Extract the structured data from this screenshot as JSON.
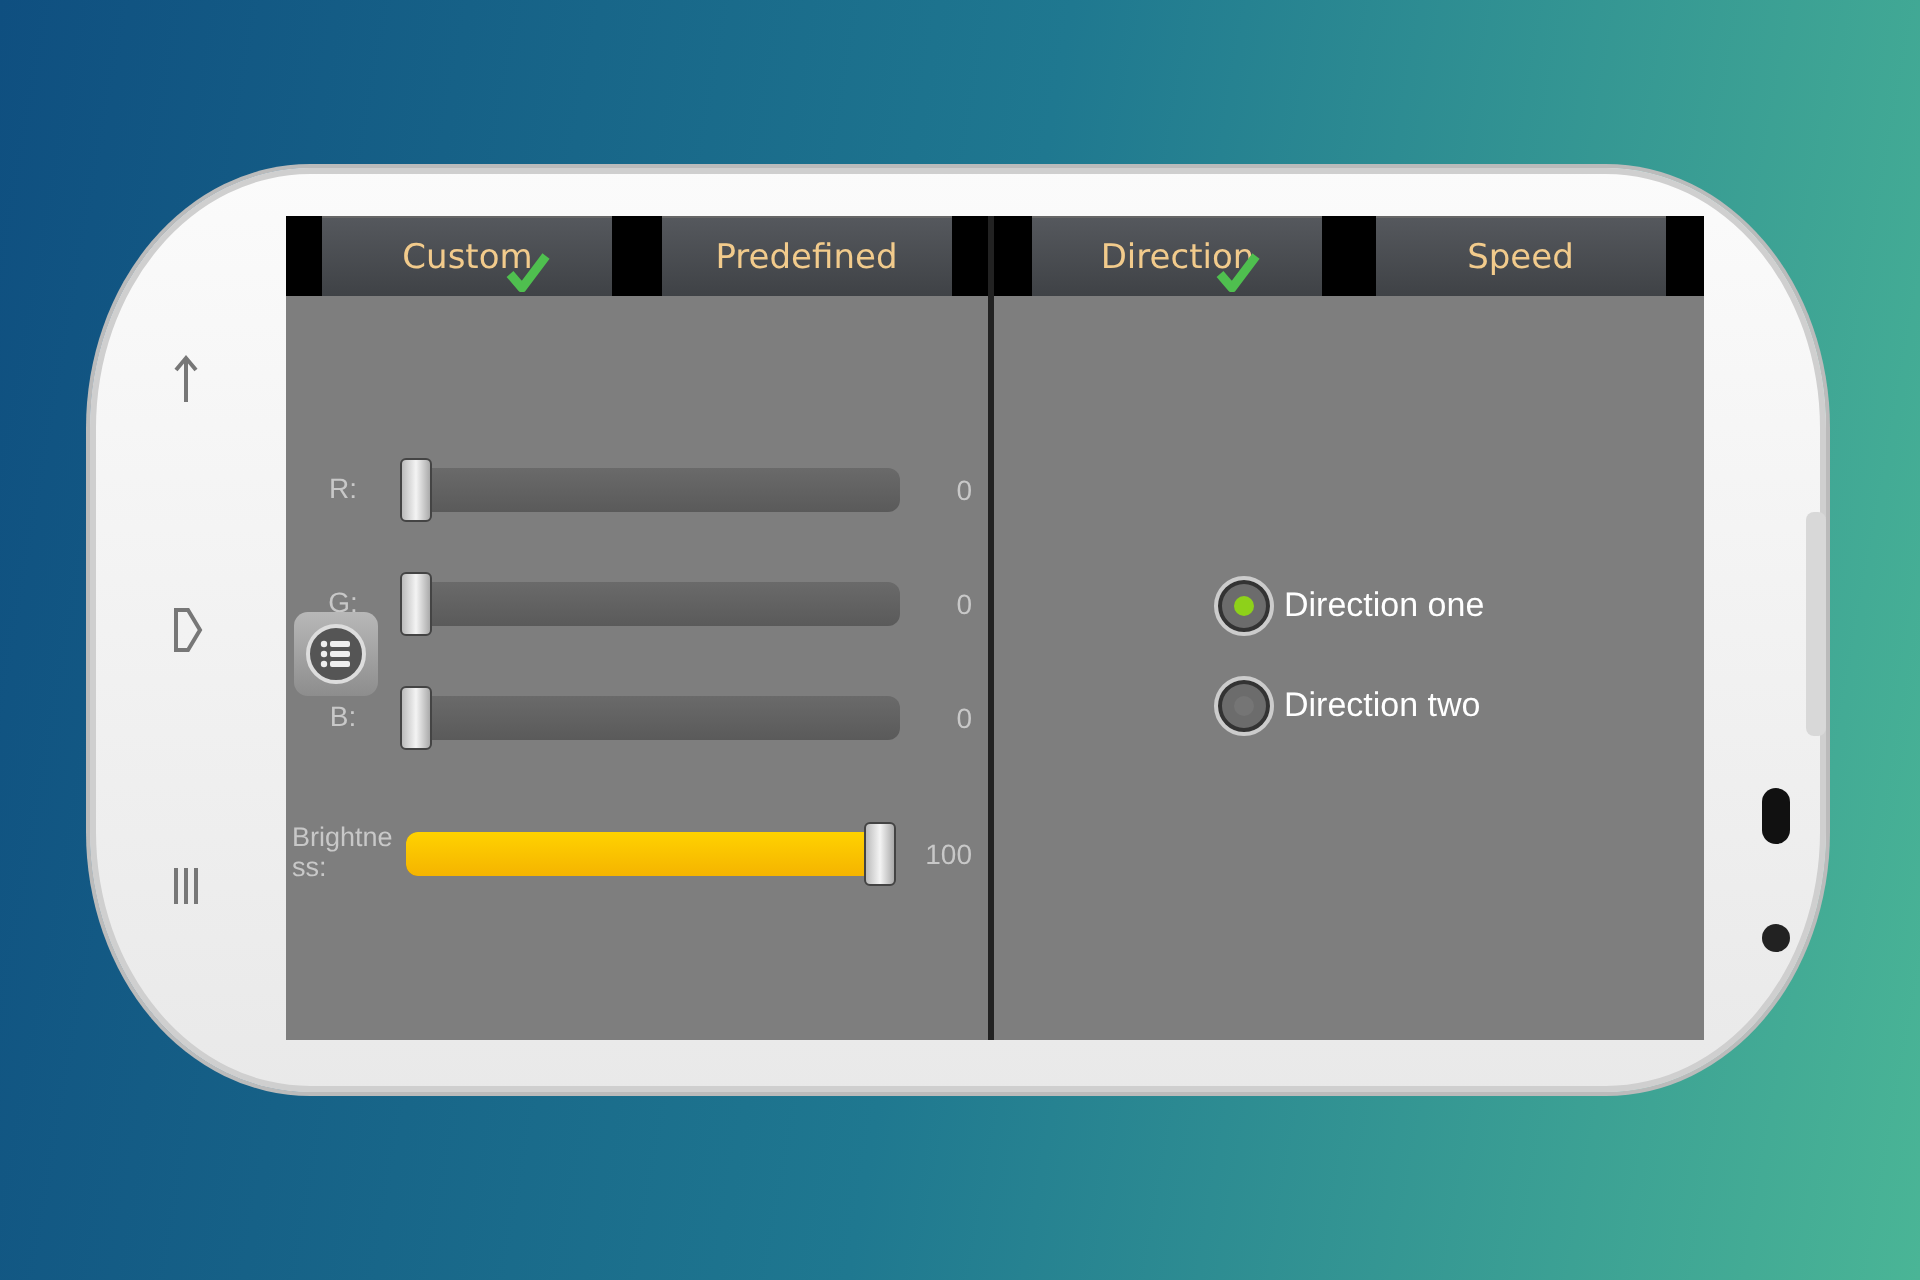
{
  "tab_groups": [
    {
      "tabs": [
        {
          "label": "Custom",
          "selected": true
        },
        {
          "label": "Predefined",
          "selected": false
        }
      ]
    },
    {
      "tabs": [
        {
          "label": "Direction",
          "selected": true
        },
        {
          "label": "Speed",
          "selected": false
        }
      ]
    }
  ],
  "sliders": [
    {
      "label": "R:",
      "level": 0,
      "reading": "0"
    },
    {
      "label": "G:",
      "level": 0,
      "reading": "0"
    },
    {
      "label": "B:",
      "level": 0,
      "reading": "0"
    },
    {
      "label": "Brightness:",
      "level": 1,
      "reading": "100"
    }
  ],
  "radios": [
    {
      "label": "Direction one",
      "selected": true
    },
    {
      "label": "Direction two",
      "selected": false
    }
  ]
}
